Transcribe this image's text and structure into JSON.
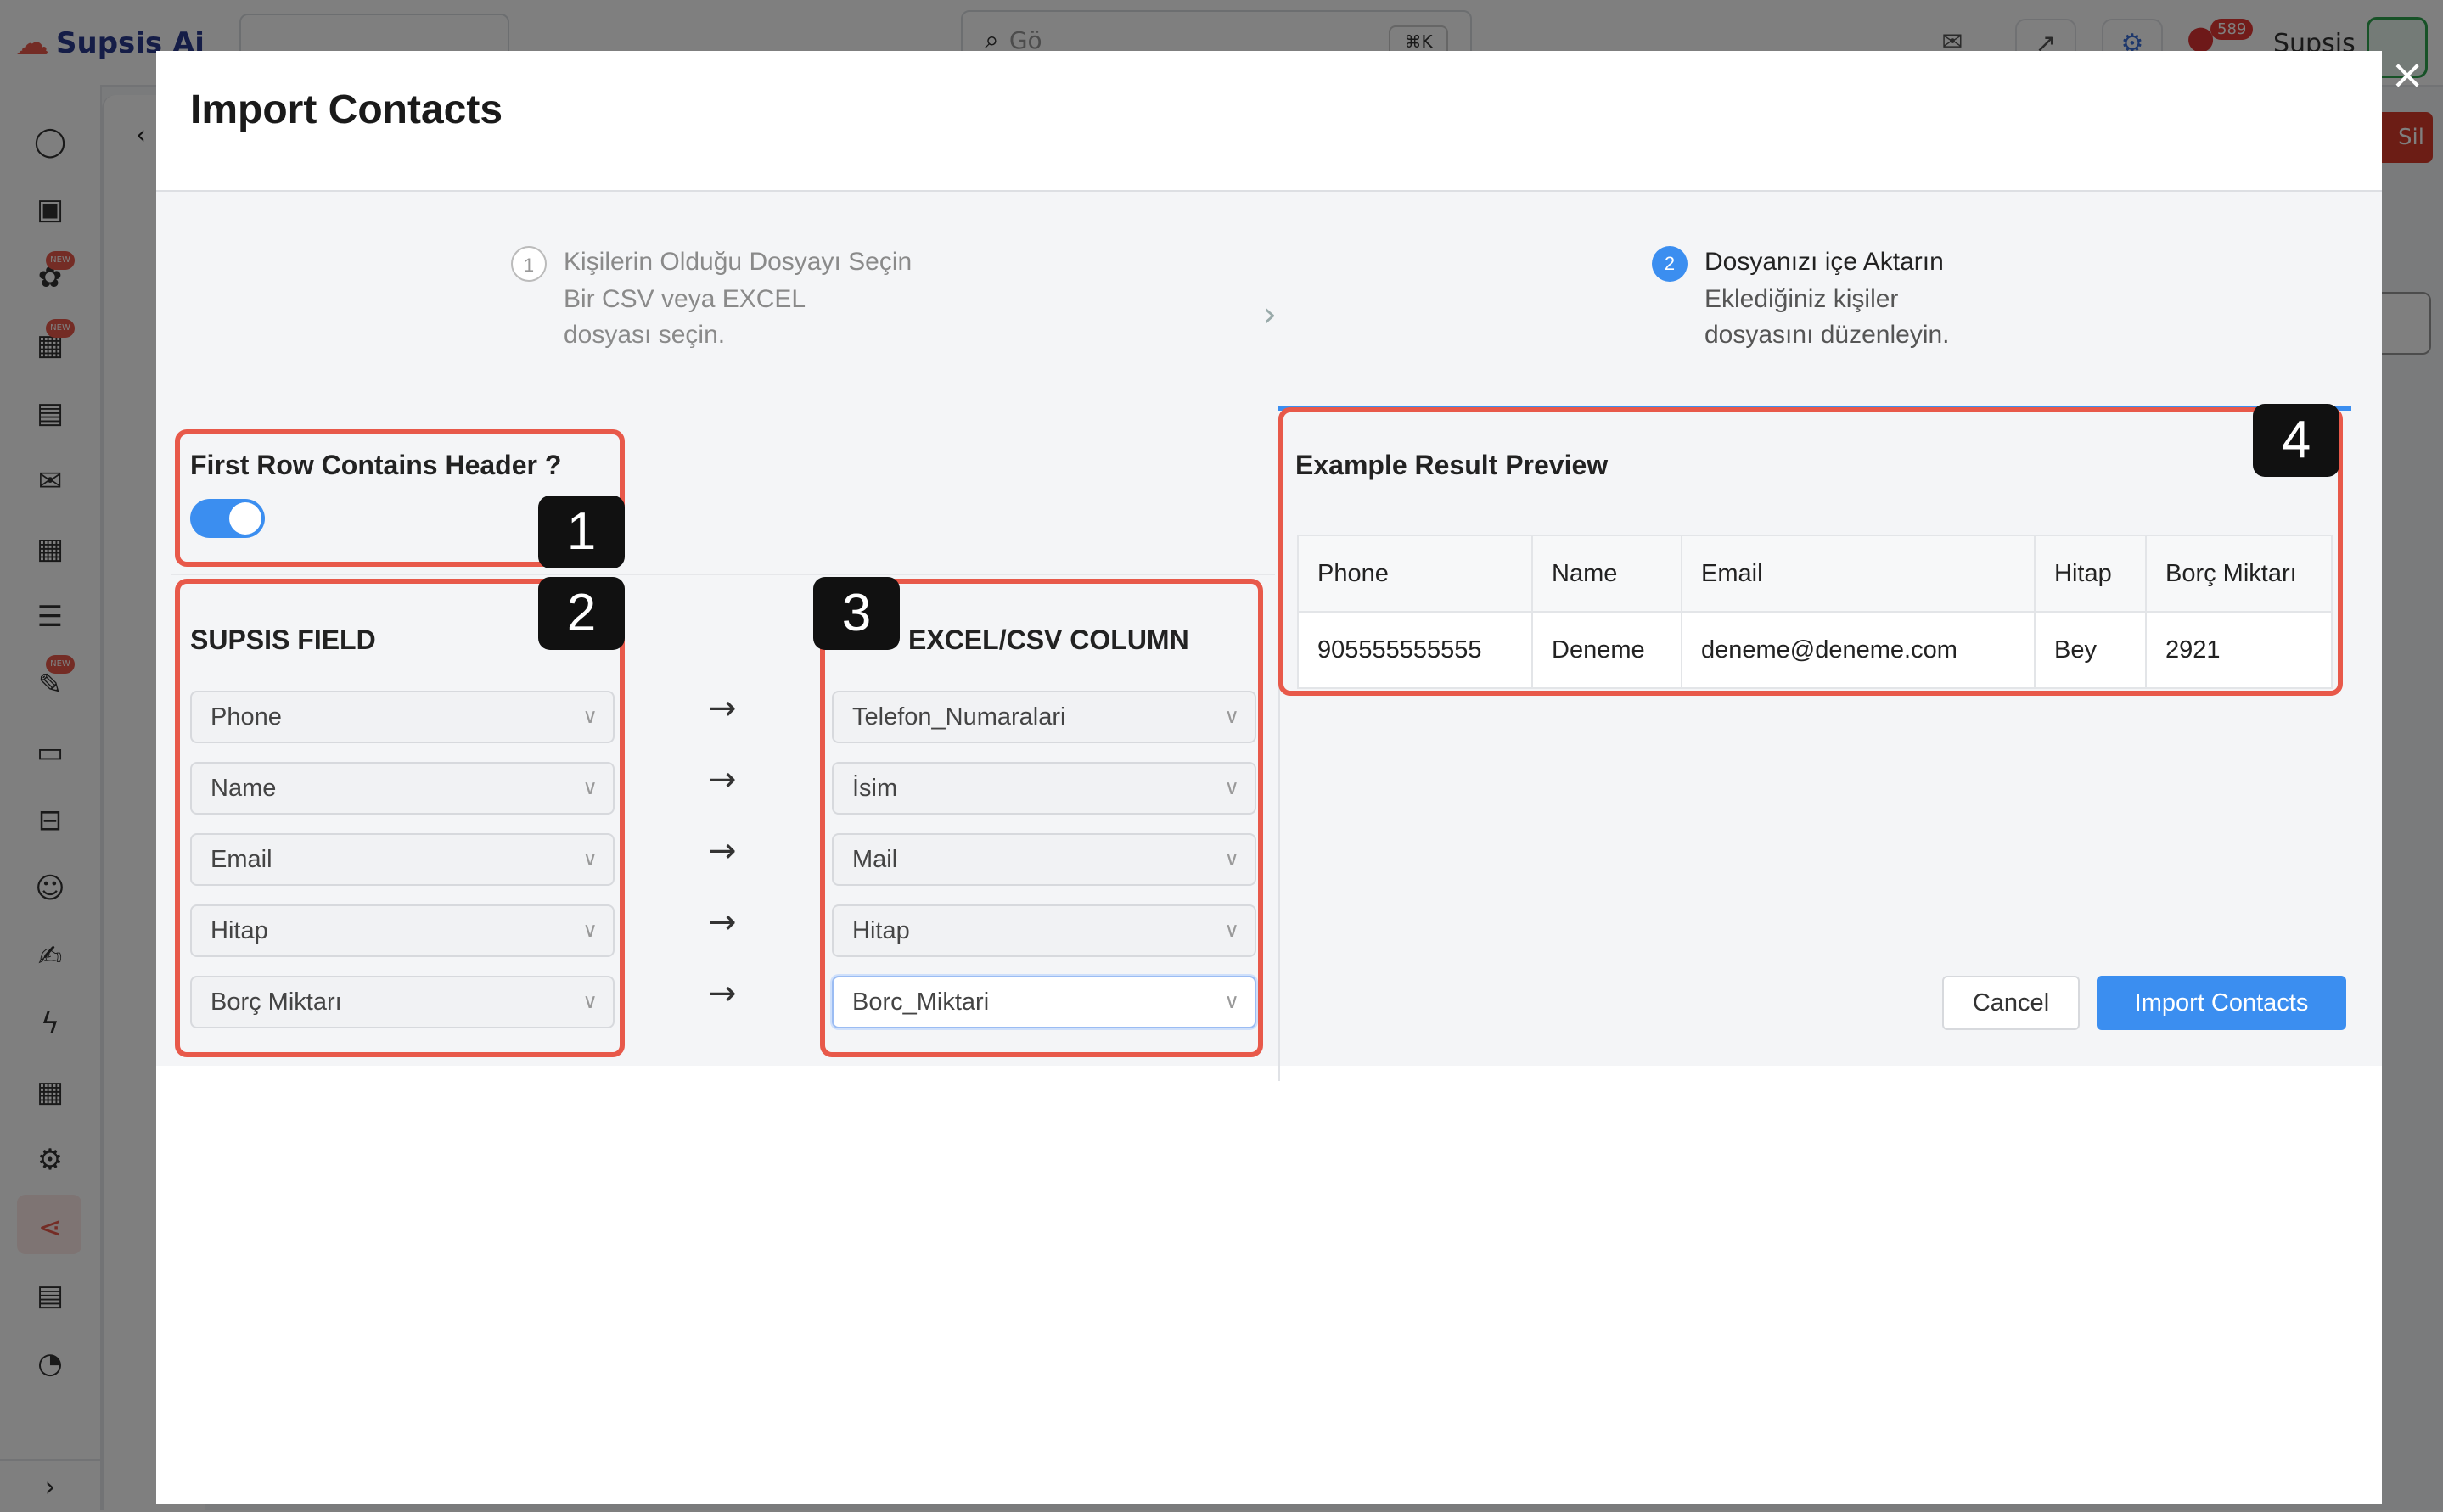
{
  "background": {
    "brand": "Supsis Ai",
    "search_placeholder": "Gö",
    "search_kbd": "⌘K",
    "notif_count": "589",
    "user": "Supsis",
    "right_button": "Sil"
  },
  "modal": {
    "title": "Import Contacts",
    "close_icon": "×",
    "steps": [
      {
        "number": "1",
        "title": "Kişilerin Olduğu Dosyayı Seçin",
        "desc": "Bir CSV veya EXCEL dosyası seçin."
      },
      {
        "number": "2",
        "title": "Dosyanızı içe Aktarın",
        "desc": "Eklediğiniz kişiler dosyasını düzenleyin."
      }
    ],
    "header_toggle": {
      "label": "First Row Contains Header ?",
      "on": true
    },
    "supsis_field_label": "SUPSIS FIELD",
    "excel_column_label": "EXCEL/CSV COLUMN",
    "mappings": [
      {
        "field": "Phone",
        "column": "Telefon_Numaralari"
      },
      {
        "field": "Name",
        "column": "İsim"
      },
      {
        "field": "Email",
        "column": "Mail"
      },
      {
        "field": "Hitap",
        "column": "Hitap"
      },
      {
        "field": "Borç Miktarı",
        "column": "Borc_Miktari"
      }
    ],
    "preview": {
      "title": "Example Result Preview",
      "columns": [
        "Phone",
        "Name",
        "Email",
        "Hitap",
        "Borç Miktarı"
      ],
      "row": [
        "905555555555",
        "Deneme",
        "deneme@deneme.com",
        "Bey",
        "2921"
      ]
    },
    "cancel_label": "Cancel",
    "import_label": "Import Contacts"
  },
  "annotations": [
    "1",
    "2",
    "3",
    "4"
  ],
  "colors": {
    "accent": "#3b8ef0",
    "annotation": "#e8594a",
    "brand": "#2b3a8f"
  }
}
